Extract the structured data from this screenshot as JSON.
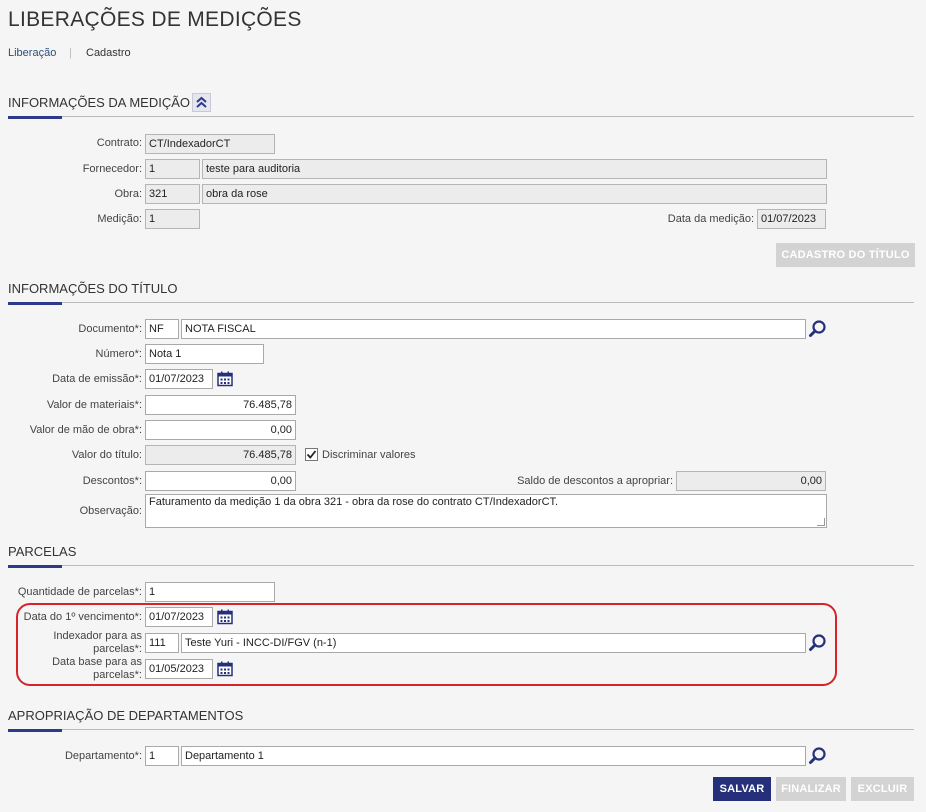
{
  "page_title": "LIBERAÇÕES DE MEDIÇÕES",
  "breadcrumb": {
    "link": "Liberação",
    "separator": "|",
    "current": "Cadastro"
  },
  "medicao": {
    "title": "INFORMAÇÕES DA MEDIÇÃO",
    "contrato_label": "Contrato:",
    "contrato_value": "CT/IndexadorCT",
    "fornecedor_label": "Fornecedor:",
    "fornecedor_code": "1",
    "fornecedor_name": "teste para auditoria",
    "obra_label": "Obra:",
    "obra_code": "321",
    "obra_name": "obra da rose",
    "medicao_label": "Medição:",
    "medicao_value": "1",
    "data_label": "Data da medição:",
    "data_value": "01/07/2023",
    "cadastro_button": "CADASTRO DO TÍTULO"
  },
  "titulo": {
    "title": "INFORMAÇÕES DO TÍTULO",
    "documento_label": "Documento*:",
    "documento_code": "NF",
    "documento_name": "NOTA FISCAL",
    "numero_label": "Número*:",
    "numero_value": "Nota 1",
    "emissao_label": "Data de emissão*:",
    "emissao_value": "01/07/2023",
    "materiais_label": "Valor de materiais*:",
    "materiais_value": "76.485,78",
    "mao_obra_label": "Valor de mão de obra*:",
    "mao_obra_value": "0,00",
    "valor_titulo_label": "Valor do título:",
    "valor_titulo_value": "76.485,78",
    "discriminar_label": "Discriminar valores",
    "discriminar_checked": true,
    "descontos_label": "Descontos*:",
    "descontos_value": "0,00",
    "saldo_label": "Saldo de descontos a apropriar:",
    "saldo_value": "0,00",
    "observacao_label": "Observação:",
    "observacao_value": "Faturamento da medição 1 da obra 321 - obra da rose do contrato CT/IndexadorCT."
  },
  "parcelas": {
    "title": "PARCELAS",
    "quantidade_label": "Quantidade de parcelas*:",
    "quantidade_value": "1",
    "vencimento_label": "Data do 1º vencimento*:",
    "vencimento_value": "01/07/2023",
    "indexador_label_1": "Indexador para as",
    "indexador_label_2": "parcelas*:",
    "indexador_code": "111",
    "indexador_name": "Teste Yuri -  INCC-DI/FGV (n-1)",
    "data_base_label_1": "Data base para as",
    "data_base_label_2": "parcelas*:",
    "data_base_value": "01/05/2023"
  },
  "departamentos": {
    "title": "APROPRIAÇÃO DE DEPARTAMENTOS",
    "departamento_label": "Departamento*:",
    "departamento_code": "1",
    "departamento_name": "Departamento 1"
  },
  "actions": {
    "salvar": "SALVAR",
    "finalizar": "FINALIZAR",
    "excluir": "EXCLUIR"
  },
  "colors": {
    "primary": "#26307a",
    "accent": "#2d3a8c",
    "highlight": "#d8232a",
    "disabled": "#d3d3d3"
  },
  "icons": {
    "collapse": "double-chevron-up-icon",
    "search": "magnifier-icon",
    "calendar": "calendar-icon",
    "checkbox": "checkmark-icon"
  }
}
